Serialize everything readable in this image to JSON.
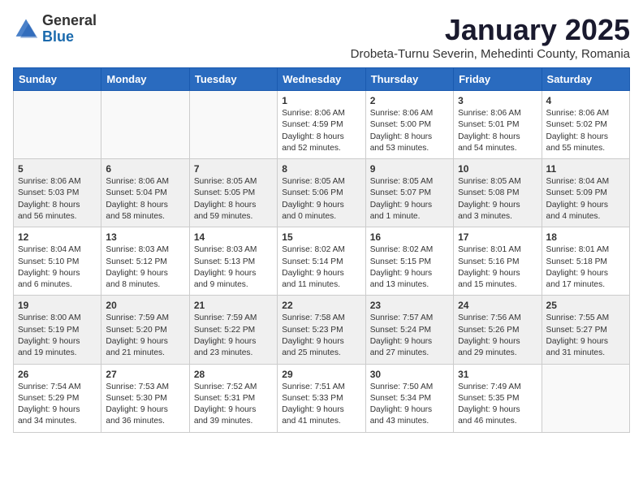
{
  "header": {
    "logo_general": "General",
    "logo_blue": "Blue",
    "month": "January 2025",
    "location": "Drobeta-Turnu Severin, Mehedinti County, Romania"
  },
  "weekdays": [
    "Sunday",
    "Monday",
    "Tuesday",
    "Wednesday",
    "Thursday",
    "Friday",
    "Saturday"
  ],
  "weeks": [
    [
      {
        "day": "",
        "info": ""
      },
      {
        "day": "",
        "info": ""
      },
      {
        "day": "",
        "info": ""
      },
      {
        "day": "1",
        "info": "Sunrise: 8:06 AM\nSunset: 4:59 PM\nDaylight: 8 hours\nand 52 minutes."
      },
      {
        "day": "2",
        "info": "Sunrise: 8:06 AM\nSunset: 5:00 PM\nDaylight: 8 hours\nand 53 minutes."
      },
      {
        "day": "3",
        "info": "Sunrise: 8:06 AM\nSunset: 5:01 PM\nDaylight: 8 hours\nand 54 minutes."
      },
      {
        "day": "4",
        "info": "Sunrise: 8:06 AM\nSunset: 5:02 PM\nDaylight: 8 hours\nand 55 minutes."
      }
    ],
    [
      {
        "day": "5",
        "info": "Sunrise: 8:06 AM\nSunset: 5:03 PM\nDaylight: 8 hours\nand 56 minutes."
      },
      {
        "day": "6",
        "info": "Sunrise: 8:06 AM\nSunset: 5:04 PM\nDaylight: 8 hours\nand 58 minutes."
      },
      {
        "day": "7",
        "info": "Sunrise: 8:05 AM\nSunset: 5:05 PM\nDaylight: 8 hours\nand 59 minutes."
      },
      {
        "day": "8",
        "info": "Sunrise: 8:05 AM\nSunset: 5:06 PM\nDaylight: 9 hours\nand 0 minutes."
      },
      {
        "day": "9",
        "info": "Sunrise: 8:05 AM\nSunset: 5:07 PM\nDaylight: 9 hours\nand 1 minute."
      },
      {
        "day": "10",
        "info": "Sunrise: 8:05 AM\nSunset: 5:08 PM\nDaylight: 9 hours\nand 3 minutes."
      },
      {
        "day": "11",
        "info": "Sunrise: 8:04 AM\nSunset: 5:09 PM\nDaylight: 9 hours\nand 4 minutes."
      }
    ],
    [
      {
        "day": "12",
        "info": "Sunrise: 8:04 AM\nSunset: 5:10 PM\nDaylight: 9 hours\nand 6 minutes."
      },
      {
        "day": "13",
        "info": "Sunrise: 8:03 AM\nSunset: 5:12 PM\nDaylight: 9 hours\nand 8 minutes."
      },
      {
        "day": "14",
        "info": "Sunrise: 8:03 AM\nSunset: 5:13 PM\nDaylight: 9 hours\nand 9 minutes."
      },
      {
        "day": "15",
        "info": "Sunrise: 8:02 AM\nSunset: 5:14 PM\nDaylight: 9 hours\nand 11 minutes."
      },
      {
        "day": "16",
        "info": "Sunrise: 8:02 AM\nSunset: 5:15 PM\nDaylight: 9 hours\nand 13 minutes."
      },
      {
        "day": "17",
        "info": "Sunrise: 8:01 AM\nSunset: 5:16 PM\nDaylight: 9 hours\nand 15 minutes."
      },
      {
        "day": "18",
        "info": "Sunrise: 8:01 AM\nSunset: 5:18 PM\nDaylight: 9 hours\nand 17 minutes."
      }
    ],
    [
      {
        "day": "19",
        "info": "Sunrise: 8:00 AM\nSunset: 5:19 PM\nDaylight: 9 hours\nand 19 minutes."
      },
      {
        "day": "20",
        "info": "Sunrise: 7:59 AM\nSunset: 5:20 PM\nDaylight: 9 hours\nand 21 minutes."
      },
      {
        "day": "21",
        "info": "Sunrise: 7:59 AM\nSunset: 5:22 PM\nDaylight: 9 hours\nand 23 minutes."
      },
      {
        "day": "22",
        "info": "Sunrise: 7:58 AM\nSunset: 5:23 PM\nDaylight: 9 hours\nand 25 minutes."
      },
      {
        "day": "23",
        "info": "Sunrise: 7:57 AM\nSunset: 5:24 PM\nDaylight: 9 hours\nand 27 minutes."
      },
      {
        "day": "24",
        "info": "Sunrise: 7:56 AM\nSunset: 5:26 PM\nDaylight: 9 hours\nand 29 minutes."
      },
      {
        "day": "25",
        "info": "Sunrise: 7:55 AM\nSunset: 5:27 PM\nDaylight: 9 hours\nand 31 minutes."
      }
    ],
    [
      {
        "day": "26",
        "info": "Sunrise: 7:54 AM\nSunset: 5:29 PM\nDaylight: 9 hours\nand 34 minutes."
      },
      {
        "day": "27",
        "info": "Sunrise: 7:53 AM\nSunset: 5:30 PM\nDaylight: 9 hours\nand 36 minutes."
      },
      {
        "day": "28",
        "info": "Sunrise: 7:52 AM\nSunset: 5:31 PM\nDaylight: 9 hours\nand 39 minutes."
      },
      {
        "day": "29",
        "info": "Sunrise: 7:51 AM\nSunset: 5:33 PM\nDaylight: 9 hours\nand 41 minutes."
      },
      {
        "day": "30",
        "info": "Sunrise: 7:50 AM\nSunset: 5:34 PM\nDaylight: 9 hours\nand 43 minutes."
      },
      {
        "day": "31",
        "info": "Sunrise: 7:49 AM\nSunset: 5:35 PM\nDaylight: 9 hours\nand 46 minutes."
      },
      {
        "day": "",
        "info": ""
      }
    ]
  ]
}
